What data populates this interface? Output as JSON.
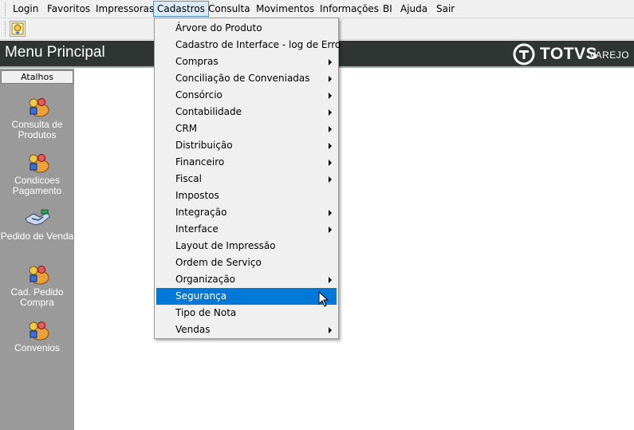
{
  "menubar": {
    "items": [
      {
        "label": "Login"
      },
      {
        "label": "Favoritos"
      },
      {
        "label": "Impressoras"
      },
      {
        "label": "Cadastros"
      },
      {
        "label": "Consulta"
      },
      {
        "label": "Movimentos"
      },
      {
        "label": "Informações"
      },
      {
        "label": "BI"
      },
      {
        "label": "Ajuda"
      },
      {
        "label": "Sair"
      }
    ],
    "active": "Cadastros"
  },
  "header": {
    "title": "Menu Principal",
    "logo_text": "TOTVS",
    "logo_sub": "VAREJO"
  },
  "sidebar": {
    "tab_label": "Atalhos",
    "items": [
      {
        "label": "Consulta de Produtos",
        "icon": "people-group-icon"
      },
      {
        "label": "Condicoes Pagamento",
        "icon": "people-group-icon"
      },
      {
        "label": "Pedido de Venda",
        "icon": "handshake-icon"
      },
      {
        "label": "Cad. Pedido Compra",
        "icon": "people-group-icon"
      },
      {
        "label": "Convenios",
        "icon": "people-group-icon"
      }
    ]
  },
  "dropdown": {
    "items": [
      {
        "label": "Árvore do Produto",
        "submenu": false
      },
      {
        "label": "Cadastro de Interface - log de Erro",
        "submenu": false
      },
      {
        "label": "Compras",
        "submenu": true
      },
      {
        "label": "Conciliação de Conveniadas",
        "submenu": true
      },
      {
        "label": "Consórcio",
        "submenu": true
      },
      {
        "label": "Contabilidade",
        "submenu": true
      },
      {
        "label": "CRM",
        "submenu": true
      },
      {
        "label": "Distribuição",
        "submenu": true
      },
      {
        "label": "Financeiro",
        "submenu": true
      },
      {
        "label": "Fiscal",
        "submenu": true
      },
      {
        "label": "Impostos",
        "submenu": false
      },
      {
        "label": "Integração",
        "submenu": true
      },
      {
        "label": "Interface",
        "submenu": true
      },
      {
        "label": "Layout de Impressão",
        "submenu": false
      },
      {
        "label": "Ordem de Serviço",
        "submenu": false
      },
      {
        "label": "Organização",
        "submenu": true
      },
      {
        "label": "Segurança",
        "submenu": false,
        "highlighted": true
      },
      {
        "label": "Tipo de Nota",
        "submenu": false
      },
      {
        "label": "Vendas",
        "submenu": true
      }
    ]
  },
  "colors": {
    "header_bg": "#2e3533",
    "sidebar_bg": "#9a9a9a",
    "highlight": "#0078d7"
  }
}
